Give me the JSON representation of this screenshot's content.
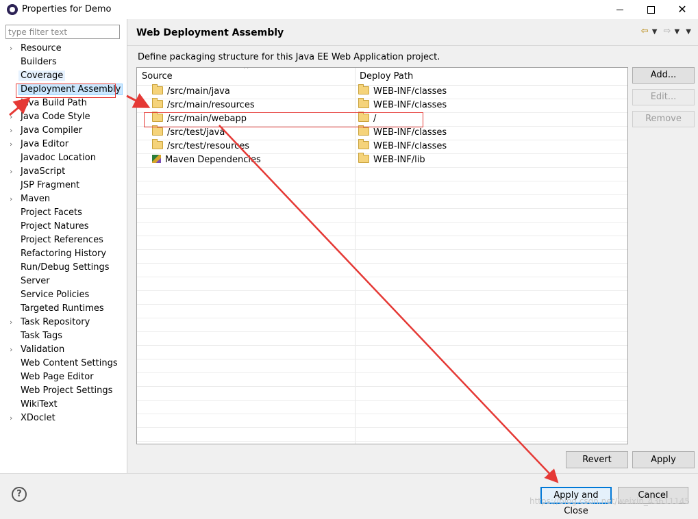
{
  "window": {
    "title": "Properties for Demo",
    "minimize": "—",
    "maximize": "☐",
    "close": "✕"
  },
  "filter": {
    "placeholder": "type filter text"
  },
  "tree": [
    {
      "label": "Resource",
      "expandable": true
    },
    {
      "label": "Builders",
      "expandable": false
    },
    {
      "label": "Coverage",
      "expandable": false
    },
    {
      "label": "Deployment Assembly",
      "expandable": false,
      "selected": true
    },
    {
      "label": "Java Build Path",
      "expandable": false
    },
    {
      "label": "Java Code Style",
      "expandable": true
    },
    {
      "label": "Java Compiler",
      "expandable": true
    },
    {
      "label": "Java Editor",
      "expandable": true
    },
    {
      "label": "Javadoc Location",
      "expandable": false
    },
    {
      "label": "JavaScript",
      "expandable": true
    },
    {
      "label": "JSP Fragment",
      "expandable": false
    },
    {
      "label": "Maven",
      "expandable": true
    },
    {
      "label": "Project Facets",
      "expandable": false
    },
    {
      "label": "Project Natures",
      "expandable": false
    },
    {
      "label": "Project References",
      "expandable": false
    },
    {
      "label": "Refactoring History",
      "expandable": false
    },
    {
      "label": "Run/Debug Settings",
      "expandable": false
    },
    {
      "label": "Server",
      "expandable": false
    },
    {
      "label": "Service Policies",
      "expandable": false
    },
    {
      "label": "Targeted Runtimes",
      "expandable": false
    },
    {
      "label": "Task Repository",
      "expandable": true
    },
    {
      "label": "Task Tags",
      "expandable": false
    },
    {
      "label": "Validation",
      "expandable": true
    },
    {
      "label": "Web Content Settings",
      "expandable": false
    },
    {
      "label": "Web Page Editor",
      "expandable": false
    },
    {
      "label": "Web Project Settings",
      "expandable": false
    },
    {
      "label": "WikiText",
      "expandable": false
    },
    {
      "label": "XDoclet",
      "expandable": true
    }
  ],
  "page": {
    "title": "Web Deployment Assembly",
    "description": "Define packaging structure for this Java EE Web Application project."
  },
  "table": {
    "columns": [
      "Source",
      "Deploy Path"
    ],
    "rows": [
      {
        "source": "/src/main/java",
        "deploy": "WEB-INF/classes",
        "icon": "folder-icon"
      },
      {
        "source": "/src/main/resources",
        "deploy": "WEB-INF/classes",
        "icon": "folder-icon"
      },
      {
        "source": "/src/main/webapp",
        "deploy": "/",
        "icon": "folder-icon"
      },
      {
        "source": "/src/test/java",
        "deploy": "WEB-INF/classes",
        "icon": "folder-icon"
      },
      {
        "source": "/src/test/resources",
        "deploy": "WEB-INF/classes",
        "icon": "folder-icon"
      },
      {
        "source": "Maven Dependencies",
        "deploy": "WEB-INF/lib",
        "icon": "library-icon"
      }
    ]
  },
  "buttons": {
    "add": "Add...",
    "edit": "Edit...",
    "remove": "Remove",
    "revert": "Revert",
    "apply": "Apply",
    "apply_close": "Apply and Close",
    "cancel": "Cancel",
    "help": "?"
  },
  "watermark": "https://blog.csdn.net/weixin_43611145",
  "colors": {
    "annotation": "#e53935",
    "selection": "#cce8ff",
    "default_button_border": "#0078d7"
  }
}
